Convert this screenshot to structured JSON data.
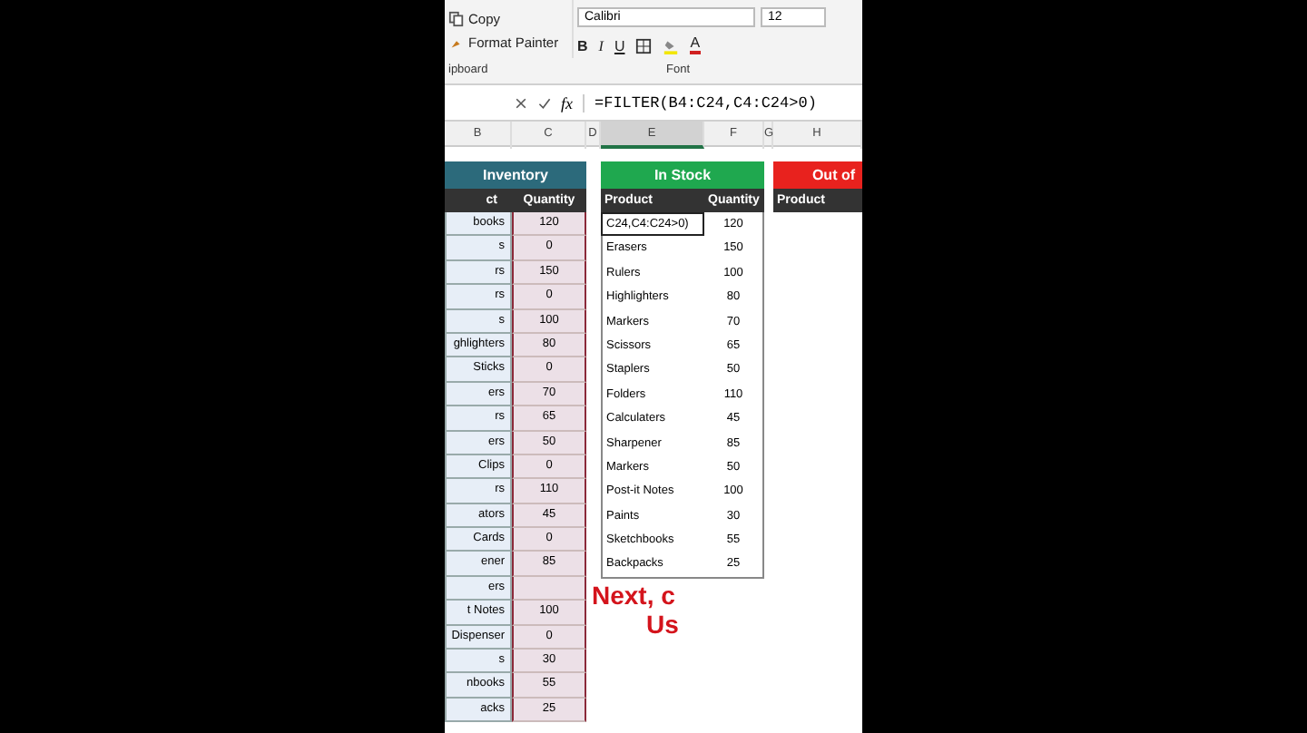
{
  "ribbon": {
    "clipboard": {
      "copy": "Copy",
      "format_painter": "Format Painter",
      "group_label": "ipboard"
    },
    "font": {
      "font_name": "Calibri",
      "font_size": "12",
      "bold": "B",
      "italic": "I",
      "underline": "U",
      "font_color": "A",
      "group_label": "Font"
    }
  },
  "formula_bar": {
    "fx": "fx",
    "formula": "=FILTER(B4:C24,C4:C24>0)"
  },
  "column_headers": [
    {
      "label": "B",
      "selected": false
    },
    {
      "label": "C",
      "selected": false
    },
    {
      "label": "D",
      "selected": false
    },
    {
      "label": "E",
      "selected": true
    },
    {
      "label": "F",
      "selected": false
    },
    {
      "label": "G",
      "selected": false
    },
    {
      "label": "H",
      "selected": false
    }
  ],
  "inventory": {
    "title": "Inventory",
    "columns": [
      "ct",
      "Quantity"
    ],
    "rows": [
      {
        "product": "books",
        "quantity": "120"
      },
      {
        "product": "s",
        "quantity": "0"
      },
      {
        "product": "rs",
        "quantity": "150"
      },
      {
        "product": "rs",
        "quantity": "0"
      },
      {
        "product": "s",
        "quantity": "100"
      },
      {
        "product": "ghlighters",
        "quantity": "80"
      },
      {
        "product": "Sticks",
        "quantity": "0"
      },
      {
        "product": "ers",
        "quantity": "70"
      },
      {
        "product": "rs",
        "quantity": "65"
      },
      {
        "product": "ers",
        "quantity": "50"
      },
      {
        "product": "Clips",
        "quantity": "0"
      },
      {
        "product": "rs",
        "quantity": "110"
      },
      {
        "product": "ators",
        "quantity": "45"
      },
      {
        "product": "Cards",
        "quantity": "0"
      },
      {
        "product": "ener",
        "quantity": "85"
      },
      {
        "product": "ers"
      },
      {
        "product": "t Notes",
        "quantity": "100"
      },
      {
        "product": "Dispenser",
        "quantity": "0"
      },
      {
        "product": "s",
        "quantity": "30"
      },
      {
        "product": "nbooks",
        "quantity": "55"
      },
      {
        "product": "acks",
        "quantity": "25"
      }
    ]
  },
  "in_stock": {
    "title": "In Stock",
    "columns": [
      "Product",
      "Quantity"
    ],
    "rows": [
      {
        "product": "C24,C4:C24>0)",
        "quantity": "120",
        "editing": true
      },
      {
        "product": "Erasers",
        "quantity": "150",
        "editing": false
      },
      {
        "product": "Rulers",
        "quantity": "100",
        "editing": false
      },
      {
        "product": "Highlighters",
        "quantity": "80",
        "editing": false
      },
      {
        "product": "Markers",
        "quantity": "70",
        "editing": false
      },
      {
        "product": "Scissors",
        "quantity": "65",
        "editing": false
      },
      {
        "product": "Staplers",
        "quantity": "50",
        "editing": false
      },
      {
        "product": "Folders",
        "quantity": "110",
        "editing": false
      },
      {
        "product": "Calculaters",
        "quantity": "45",
        "editing": false
      },
      {
        "product": "Sharpener",
        "quantity": "85",
        "editing": false
      },
      {
        "product": "Markers",
        "quantity": "50",
        "editing": false
      },
      {
        "product": "Post-it Notes",
        "quantity": "100",
        "editing": false
      },
      {
        "product": "Paints",
        "quantity": "30",
        "editing": false
      },
      {
        "product": "Sketchbooks",
        "quantity": "55",
        "editing": false
      },
      {
        "product": "Backpacks",
        "quantity": "25",
        "editing": false
      }
    ]
  },
  "out_of_stock": {
    "title": "Out of",
    "columns": [
      "Product"
    ]
  },
  "caption": [
    "Next, c",
    "Us"
  ]
}
